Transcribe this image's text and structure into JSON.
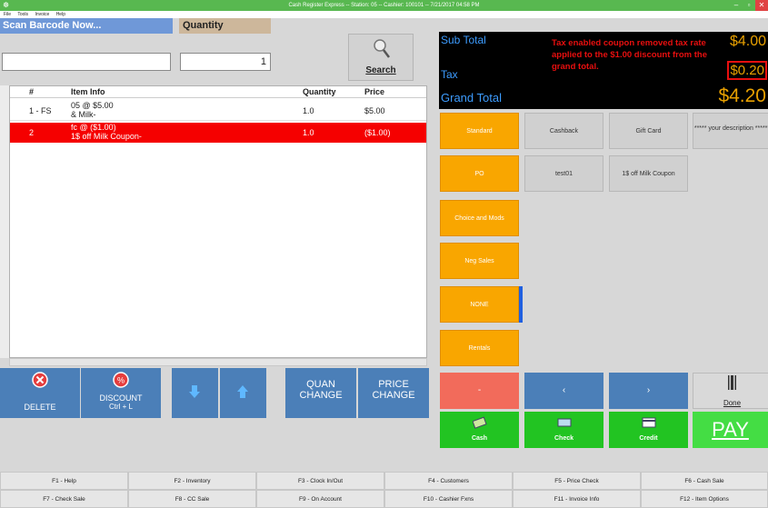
{
  "window": {
    "title": "Cash Register Express -- Station: 05 -- Cashier: 100101 -- 7/21/2017 04:58 PM"
  },
  "menu": [
    "File",
    "Tools",
    "Invoice",
    "Help"
  ],
  "scan": {
    "label": "Scan Barcode Now...",
    "value": ""
  },
  "quantity": {
    "label": "Quantity",
    "value": "1"
  },
  "search": {
    "label": "Search"
  },
  "table": {
    "headers": [
      "#",
      "Item Info",
      "Quantity",
      "Price"
    ],
    "rows": [
      {
        "num": "1 - FS",
        "line1": "05 @  $5.00",
        "line2": "& Milk-",
        "qty": "1.0",
        "price": "$5.00",
        "selected": false
      },
      {
        "num": "2",
        "line1": "fc @  ($1.00)",
        "line2": "1$ off Milk Coupon-",
        "qty": "1.0",
        "price": "($1.00)",
        "selected": true
      }
    ]
  },
  "actions": {
    "delete": "DELETE",
    "discount": "DISCOUNT",
    "discount_key": "Ctrl + L",
    "quan1": "QUAN",
    "quan2": "CHANGE",
    "price1": "PRICE",
    "price2": "CHANGE"
  },
  "display": {
    "subtotal_label": "Sub Total",
    "tax_label": "Tax",
    "grand_label": "Grand Total",
    "subtotal": "$4.00",
    "tax": "$0.20",
    "grand": "$4.20",
    "message": "Tax enabled coupon removed tax rate applied to the $1.00 discount from the grand total."
  },
  "categories": [
    "Standard",
    "PO",
    "Choice and Mods",
    "Neg Sales",
    "NONE",
    "Rentals"
  ],
  "quick": {
    "cashback": "Cashback",
    "gift": "Gift Card",
    "desc": "***** your description ******",
    "test": "test01",
    "coupon": "1$ off Milk Coupon"
  },
  "nav": {
    "done": "Done",
    "minus": "-"
  },
  "payments": {
    "cash": "Cash",
    "check": "Check",
    "credit": "Credit",
    "pay": "PAY"
  },
  "fkeys": [
    "F1 - Help",
    "F2 - Inventory",
    "F3 - Clock In/Out",
    "F4 - Customers",
    "F5 - Price Check",
    "F6 - Cash Sale",
    "F7 - Check Sale",
    "F8 - CC Sale",
    "F9 - On Account",
    "F10 - Cashier Fxns",
    "F11 - Invoice Info",
    "F12 - Item Options"
  ],
  "colors": {
    "orange": "#f9a600",
    "green": "#22c422",
    "blue": "#4b7fb8",
    "red": "#f50000"
  }
}
